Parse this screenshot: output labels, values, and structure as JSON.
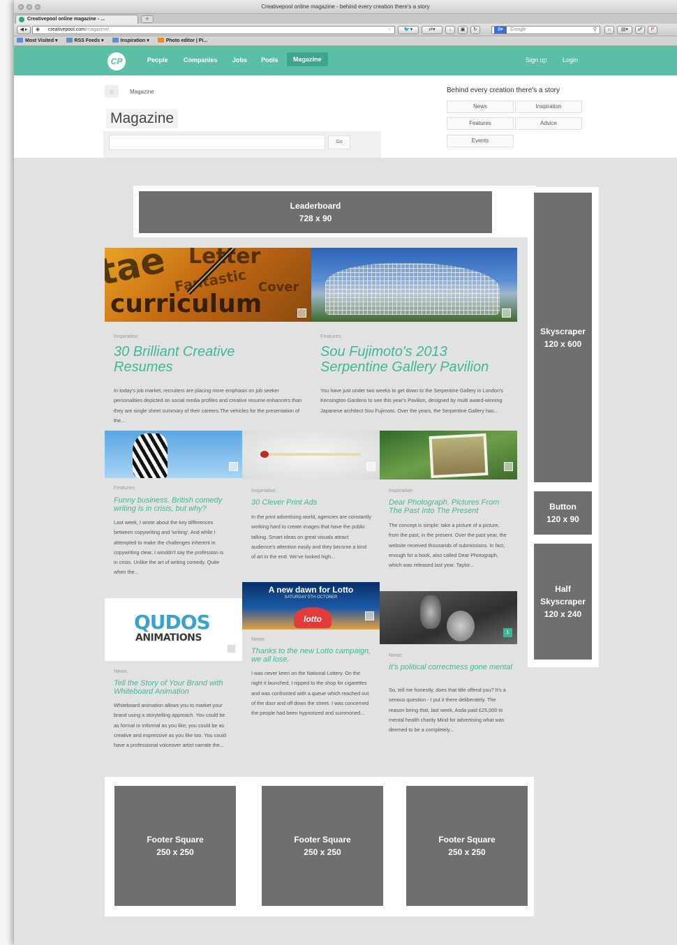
{
  "browser": {
    "window_title": "Creativepool online magazine - behind every creation there's a story",
    "tab_title": "Creativepool online magazine - ...",
    "new_tab": "+",
    "url_domain": "creativepool.com",
    "url_path": "/magazine/",
    "search_placeholder": "Google",
    "bookmarks": [
      "Most Visited",
      "RSS Feeds",
      "Inspiration",
      "Photo editor | Pi..."
    ]
  },
  "site": {
    "logo": "CP",
    "nav": [
      "People",
      "Companies",
      "Jobs",
      "Pools",
      "Magazine"
    ],
    "signup": "Sign up",
    "login": "Login"
  },
  "page": {
    "breadcrumb": "Magazine",
    "title": "Magazine",
    "search_button": "Go",
    "tagline": "Behind every creation there's a story",
    "categories": [
      "News",
      "Inspiration",
      "Features",
      "Advice",
      "Events"
    ]
  },
  "ads": {
    "leaderboard": {
      "name": "Leaderboard",
      "size": "728 x 90"
    },
    "skyscraper": {
      "name": "Skyscraper",
      "size": "120 x 600"
    },
    "button": {
      "name": "Button",
      "size": "120 x 90"
    },
    "half_skyscraper": {
      "name1": "Half",
      "name2": "Skyscraper",
      "size": "120 x 240"
    },
    "footer": [
      {
        "name": "Footer Square",
        "size": "250 x 250"
      },
      {
        "name": "Footer Square",
        "size": "250 x 250"
      },
      {
        "name": "Footer Square",
        "size": "250 x 250"
      }
    ]
  },
  "articles": {
    "resumes": {
      "category": "Inspiration",
      "title": "30 Brilliant Creative Resumes",
      "excerpt": "In today's job market, recruiters are placing more emphasis on job seeker personalities depicted on social media profiles and creative resume enhancers than they are single sheet summary of their careers.The vehicles for the presentation of the...",
      "image_words": [
        "Letter",
        "Fantastic",
        "Cover",
        "curriculum"
      ]
    },
    "serpentine": {
      "category": "Features",
      "title": "Sou Fujimoto's 2013 Serpentine Gallery Pavilion",
      "excerpt": "You have just under two weeks to get down to the Serpentine Gallery in London's Kensington Gardens to see this year's Pavilion, designed by multi award-winning Japanese architect Sou Fujimoto. Over the years, the Serpentine Gallery has..."
    },
    "comedy": {
      "category": "Features",
      "title": "Funny business. British comedy writing is in crisis, but why?",
      "excerpt": "Last week, I wrote about the key differences between copywriting and 'writing'. And while I attempted to make the challenges inherent in copywriting clear, I wouldn't say the profession is in crisis. Unlike the art of writing comedy. Quite when the..."
    },
    "printads": {
      "category": "Inspiration",
      "title": "30 Clever Print Ads",
      "excerpt": "In the print advertising world, agencies are constantly working hard to create images that have the public talking. Smart ideas on great visuals attract audience's attention easily and they become a kind of art in the end. We've looked high..."
    },
    "photograph": {
      "category": "Inspiration",
      "title": "Dear Photograph. Pictures From The Past Into The Present",
      "excerpt": "The concept is simple: take a picture of a picture, from the past, in the present. Over the past year, the website received thousands of submissions. In fact, enough for a book, also called Dear Photograph, which was released last year. Taylor..."
    },
    "qudos": {
      "category": "News",
      "title": "Tell the Story of Your Brand with Whiteboard Animation",
      "excerpt": "Whiteboard animation allows you to market your brand using a storytelling approach. You could be as formal or informal as you like; you could be as creative and expressive as you like too. You could have a professional voiceover artist narrate the...",
      "logo_line1": "QUDOS",
      "logo_line2": "ANIMATIONS"
    },
    "lotto": {
      "category": "News",
      "title": "Thanks to the new Lotto campaign, we all lose.",
      "excerpt": "I was never keen on the National Lottery. On the night it launched, I nipped to the shop for cigarettes and was confronted with a queue which reached out of the door and off down the street. I was concerned the people had been hypnotized and summoned...",
      "banner_title": "A new dawn for Lotto",
      "banner_sub": "SATURDAY 5TH OCTOBER",
      "logo": "lotto"
    },
    "political": {
      "category": "News",
      "title": "It's political correctness gone mental",
      "excerpt": "So, tell me honestly, does that title offend you? It's a serious question - I put it there deliberately. The reason being that, last week, Asda paid £25,000 to mental health charity Mind for advertising what was deemed to be a completely...",
      "comment_count": "1"
    }
  },
  "colors": {
    "brand": "#5bbfa5",
    "title_green": "#3fb79a",
    "ad_grey": "#6e6f6f"
  }
}
